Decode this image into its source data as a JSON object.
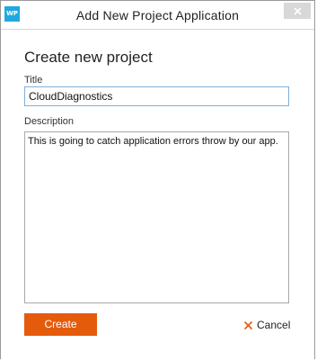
{
  "window": {
    "title": "Add New Project Application",
    "app_icon_text": "WP"
  },
  "form": {
    "heading": "Create new project",
    "title_label": "Title",
    "title_value": "CloudDiagnostics",
    "description_label": "Description",
    "description_value": "This is going to catch application errors throw by our app."
  },
  "actions": {
    "create_label": "Create",
    "cancel_label": "Cancel"
  },
  "icons": {
    "close": "close-icon",
    "cancel": "x-icon"
  },
  "colors": {
    "accent": "#e55b0c",
    "app_icon": "#21a8e0",
    "focus_border": "#7fb0d9",
    "cancel_x": "#e55b0c"
  }
}
